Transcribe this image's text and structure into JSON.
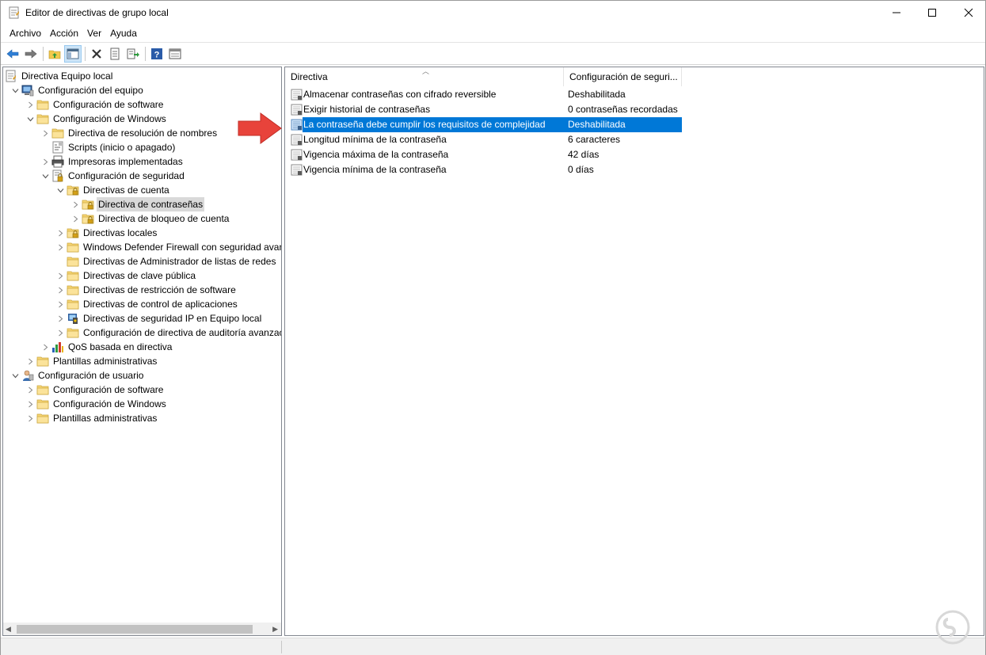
{
  "window": {
    "title": "Editor de directivas de grupo local",
    "controls": {
      "minimize": "—",
      "maximize": "☐",
      "close": "✕"
    }
  },
  "menu": {
    "items": [
      "Archivo",
      "Acción",
      "Ver",
      "Ayuda"
    ]
  },
  "toolbar": {
    "buttons": [
      "back-icon",
      "forward-icon",
      "up-folder-icon",
      "show-hide-tree-icon",
      "delete-icon",
      "properties-icon",
      "export-list-icon",
      "help-icon",
      "view-icon"
    ]
  },
  "tree": {
    "items": [
      {
        "label": "Directiva Equipo local",
        "icon": "policy-doc-icon",
        "expander": ""
      },
      {
        "label": "Configuración del equipo",
        "icon": "computer-icon",
        "expander": "open"
      },
      {
        "label": "Configuración de software",
        "icon": "folder-icon",
        "expander": "closed"
      },
      {
        "label": "Configuración de Windows",
        "icon": "folder-icon",
        "expander": "open"
      },
      {
        "label": "Directiva de resolución de nombres",
        "icon": "folder-icon",
        "expander": "closed"
      },
      {
        "label": "Scripts (inicio o apagado)",
        "icon": "scripts-icon",
        "expander": ""
      },
      {
        "label": "Impresoras implementadas",
        "icon": "printer-icon",
        "expander": "closed"
      },
      {
        "label": "Configuración de seguridad",
        "icon": "security-icon",
        "expander": "open"
      },
      {
        "label": "Directivas de cuenta",
        "icon": "locked-folder-icon",
        "expander": "open"
      },
      {
        "label": "Directiva de contraseñas",
        "icon": "locked-folder-icon",
        "expander": "closed",
        "selected": true
      },
      {
        "label": "Directiva de bloqueo de cuenta",
        "icon": "locked-folder-icon",
        "expander": "closed"
      },
      {
        "label": "Directivas locales",
        "icon": "locked-folder-icon",
        "expander": "closed"
      },
      {
        "label": "Windows Defender Firewall con seguridad avanz",
        "icon": "folder-icon",
        "expander": "closed"
      },
      {
        "label": "Directivas de Administrador de listas de redes",
        "icon": "folder-icon",
        "expander": ""
      },
      {
        "label": "Directivas de clave pública",
        "icon": "folder-icon",
        "expander": "closed"
      },
      {
        "label": "Directivas de restricción de software",
        "icon": "folder-icon",
        "expander": "closed"
      },
      {
        "label": "Directivas de control de aplicaciones",
        "icon": "folder-icon",
        "expander": "closed"
      },
      {
        "label": "Directivas de seguridad IP en Equipo local",
        "icon": "ipsec-icon",
        "expander": "closed"
      },
      {
        "label": "Configuración de directiva de auditoría avanzac",
        "icon": "folder-icon",
        "expander": "closed"
      },
      {
        "label": "QoS basada en directiva",
        "icon": "chart-icon",
        "expander": "closed"
      },
      {
        "label": "Plantillas administrativas",
        "icon": "folder-icon",
        "expander": "closed"
      },
      {
        "label": "Configuración de usuario",
        "icon": "user-icon",
        "expander": "open"
      },
      {
        "label": "Configuración de software",
        "icon": "folder-icon",
        "expander": "closed"
      },
      {
        "label": "Configuración de Windows",
        "icon": "folder-icon",
        "expander": "closed"
      },
      {
        "label": "Plantillas administrativas",
        "icon": "folder-icon",
        "expander": "closed"
      }
    ]
  },
  "list": {
    "columns": {
      "name": "Directiva",
      "value": "Configuración de seguri..."
    },
    "rows": [
      {
        "name": "Almacenar contraseñas con cifrado reversible",
        "value": "Deshabilitada"
      },
      {
        "name": "Exigir historial de contraseñas",
        "value": "0 contraseñas recordadas"
      },
      {
        "name": "La contraseña debe cumplir los requisitos de complejidad",
        "value": "Deshabilitada",
        "selected": true
      },
      {
        "name": "Longitud mínima de la contraseña",
        "value": "6 caracteres"
      },
      {
        "name": "Vigencia máxima de la contraseña",
        "value": "42 días"
      },
      {
        "name": "Vigencia mínima de la contraseña",
        "value": "0 días"
      }
    ]
  },
  "colors": {
    "selection": "#0078d7",
    "tree_selection": "#d9d9d9",
    "annotation_arrow": "#e8433b",
    "folder": "#f7d674"
  }
}
